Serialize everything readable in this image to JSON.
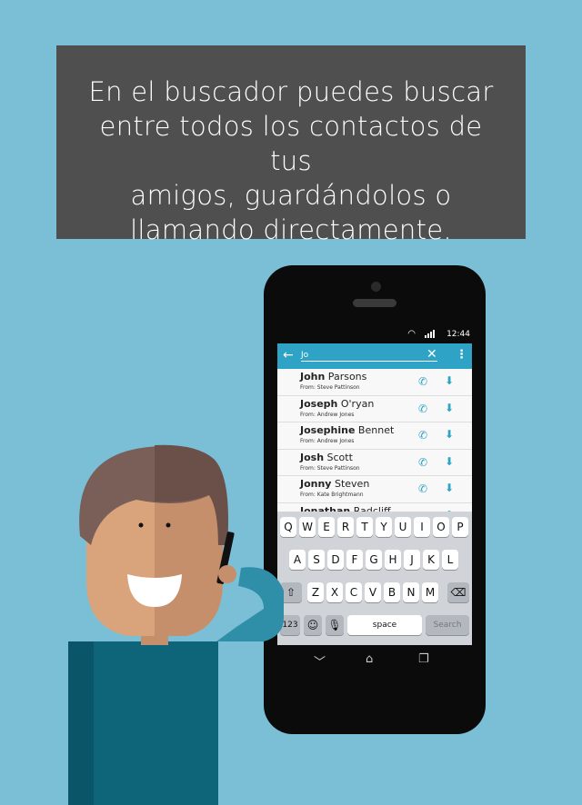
{
  "caption": {
    "lines": [
      "En el buscador puedes buscar",
      "entre todos los contactos de tus",
      "amigos, guardándolos o",
      "llamando directamente."
    ]
  },
  "status": {
    "time": "12:44",
    "wifi_icon": "wifi-icon",
    "signal_icon": "signal-icon"
  },
  "search": {
    "back_icon": "back-arrow-icon",
    "query": "Jo",
    "clear_icon": "close-icon",
    "menu_icon": "overflow-menu-icon"
  },
  "contacts": [
    {
      "first": "John",
      "last": " Parsons",
      "from": "From: Steve Pattinson"
    },
    {
      "first": "Joseph",
      "last": " O'ryan",
      "from": "From: Andrew Jones"
    },
    {
      "first": "Josephine",
      "last": " Bennet",
      "from": "From: Andrew Jones"
    },
    {
      "first": "Josh",
      "last": " Scott",
      "from": "From: Steve Pattinson"
    },
    {
      "first": "Jonny",
      "last": " Steven",
      "from": "From: Kate Brightmann"
    },
    {
      "first": "Jonathan",
      "last": " Radcliff",
      "from": ""
    }
  ],
  "keyboard": {
    "row1": [
      "Q",
      "W",
      "E",
      "R",
      "T",
      "Y",
      "U",
      "I",
      "O",
      "P"
    ],
    "row2": [
      "A",
      "S",
      "D",
      "F",
      "G",
      "H",
      "J",
      "K",
      "L"
    ],
    "row3": [
      "Z",
      "X",
      "C",
      "V",
      "B",
      "N",
      "M"
    ],
    "numbers_label": "123",
    "space_label": "space",
    "search_label": "Search"
  },
  "colors": {
    "background": "#7bbfd6",
    "caption_bg": "#4f4f4f",
    "accent": "#2ea3c6",
    "shirt": "#0e6478",
    "sleeve": "#2f8fa8",
    "skin_light": "#d9a47c",
    "skin_dark": "#c48f6a",
    "hair": "#7a5f58"
  }
}
